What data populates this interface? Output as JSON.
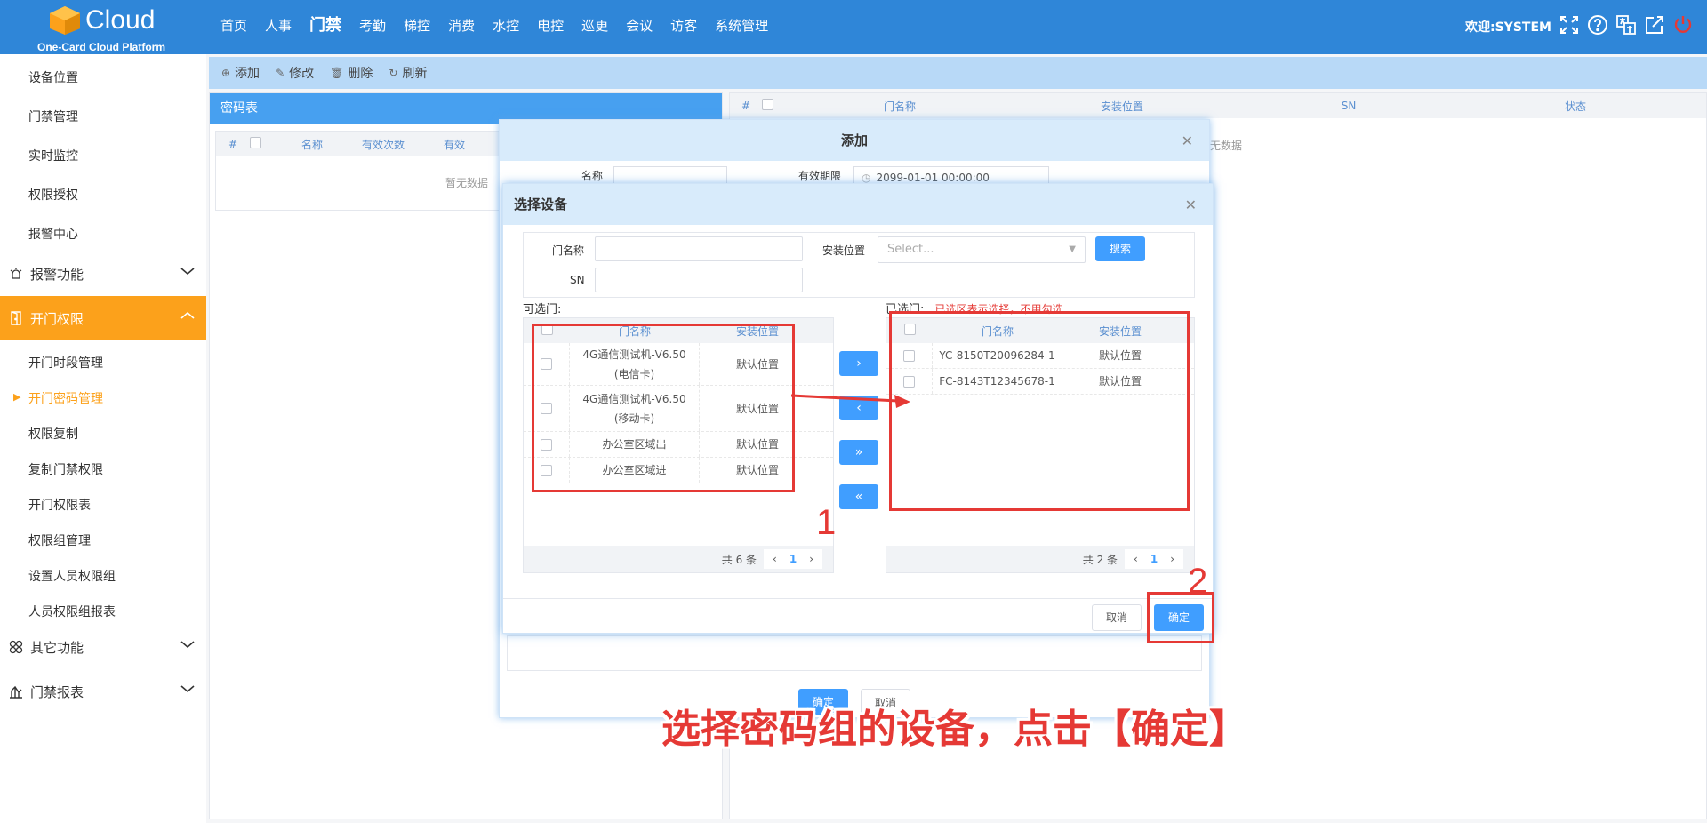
{
  "header": {
    "logo_text": "Cloud",
    "logo_sub": "One-Card Cloud Platform",
    "nav": [
      "首页",
      "人事",
      "门禁",
      "考勤",
      "梯控",
      "消费",
      "水控",
      "电控",
      "巡更",
      "会议",
      "访客",
      "系统管理"
    ],
    "nav_active": "门禁",
    "welcome": "欢迎:SYSTEM",
    "icons": [
      "fullscreen-icon",
      "help-icon",
      "translate-icon",
      "edit-external-icon",
      "power-icon"
    ]
  },
  "sidebar": {
    "top_items": [
      "设备位置",
      "门禁管理",
      "实时监控",
      "权限授权",
      "报警中心"
    ],
    "group_alarm": "报警功能",
    "group_open": "开门权限",
    "open_items": [
      "开门时段管理",
      "开门密码管理",
      "权限复制",
      "复制门禁权限",
      "开门权限表",
      "权限组管理",
      "设置人员权限组",
      "人员权限组报表"
    ],
    "current_item": "开门密码管理",
    "group_other": "其它功能",
    "group_report": "门禁报表"
  },
  "toolbar": {
    "add": "添加",
    "edit": "修改",
    "delete": "删除",
    "refresh": "刷新"
  },
  "left_panel": {
    "title": "密码表",
    "headers": [
      "#",
      "名称",
      "有效次数",
      "有效"
    ],
    "empty": "暂无数据"
  },
  "right_panel": {
    "headers": [
      "#",
      "门名称",
      "安装位置",
      "SN",
      "状态"
    ],
    "empty": "无数据"
  },
  "modal_add": {
    "title": "添加",
    "name_label": "名称",
    "valid_label": "有效期限",
    "valid_value": "2099-01-01 00:00:00",
    "btn_ok": "确定",
    "btn_cancel": "取消"
  },
  "modal_select": {
    "title": "选择设备",
    "door_name_label": "门名称",
    "install_label": "安装位置",
    "install_placeholder": "Select...",
    "sn_label": "SN",
    "search_btn": "搜索",
    "available_label": "可选门:",
    "selected_label": "已选门:",
    "selected_hint": "已选区表示选择，不用勾选",
    "col_name": "门名称",
    "col_location": "安装位置",
    "available_rows": [
      {
        "name": "4G通信测试机-V6.50(电信卡)",
        "name1": "4G通信测试机-V6.50",
        "name2": "(电信卡)",
        "location": "默认位置"
      },
      {
        "name": "4G通信测试机-V6.50(移动卡)",
        "name1": "4G通信测试机-V6.50",
        "name2": "(移动卡)",
        "location": "默认位置"
      },
      {
        "name": "办公室区域出",
        "location": "默认位置"
      },
      {
        "name": "办公室区域进",
        "location": "默认位置"
      }
    ],
    "selected_rows": [
      {
        "name": "YC-8150T20096284-1",
        "location": "默认位置"
      },
      {
        "name": "FC-8143T12345678-1",
        "location": "默认位置"
      }
    ],
    "available_total": "共 6 条",
    "selected_total": "共 2 条",
    "page": "1",
    "btn_cancel": "取消",
    "btn_ok": "确定"
  },
  "annotations": {
    "num1": "1",
    "num2": "2",
    "caption": "选择密码组的设备，点击【确定】"
  }
}
